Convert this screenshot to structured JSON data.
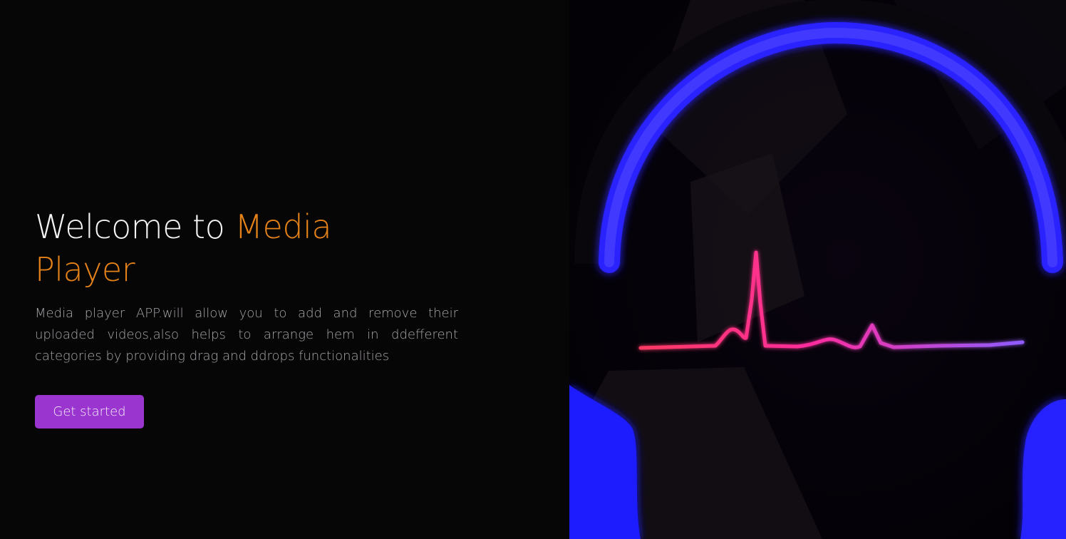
{
  "hero": {
    "title_prefix": "Welcome to ",
    "title_accent": "Media Player",
    "description": "Media player APP.will allow you to add and remove their uploaded videos,also helps to arrange hem in ddefferent categories by providing drag and ddrops functionalities",
    "cta_label": "Get started"
  },
  "colors": {
    "background": "#070607",
    "title_text": "#f4f4f4",
    "accent": "#e58218",
    "description_text": "#a9a6aa",
    "button": "#9a36cf",
    "headphone_glow": "#2a20ff",
    "pulse_start": "#ff3a64",
    "pulse_end": "#8f5cff"
  },
  "visual": {
    "icons": [
      "headphones-icon",
      "heartbeat-pulse-icon"
    ]
  }
}
